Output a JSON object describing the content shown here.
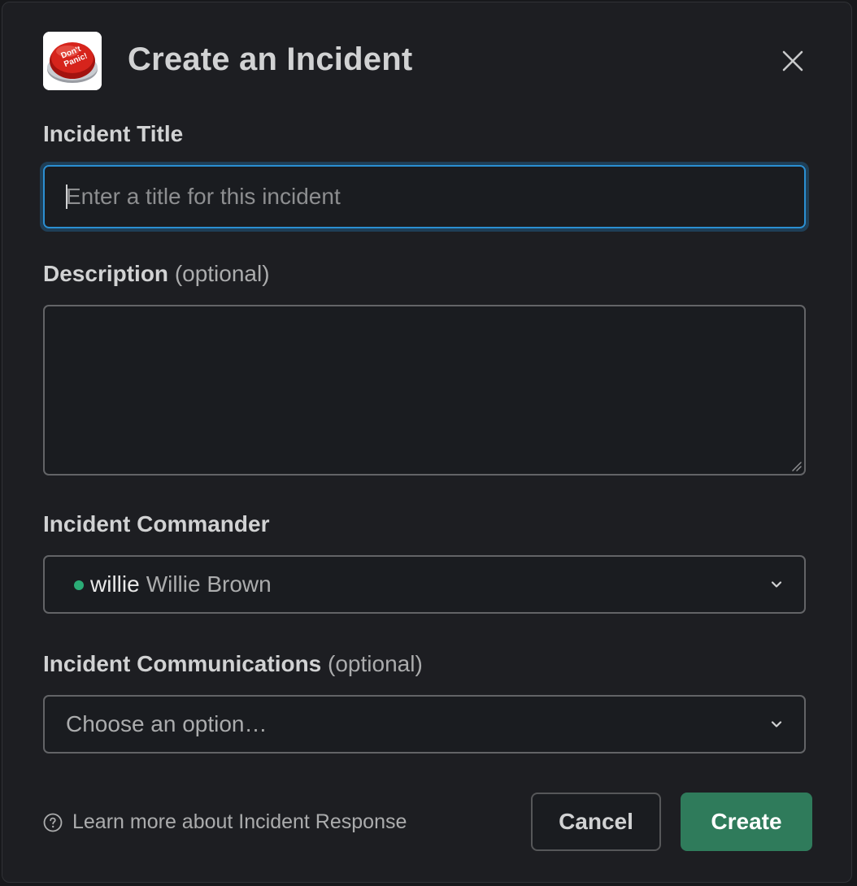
{
  "header": {
    "title": "Create an Incident",
    "app_icon": "dont-panic-button-icon",
    "app_icon_text": "Don't Panic!",
    "close_icon": "close-icon"
  },
  "form": {
    "title_field": {
      "label": "Incident Title",
      "placeholder": "Enter a title for this incident",
      "value": ""
    },
    "description_field": {
      "label": "Description",
      "optional_label": "(optional)",
      "value": ""
    },
    "commander_field": {
      "label": "Incident Commander",
      "selected_handle": "willie",
      "selected_name": "Willie Brown",
      "presence": "active"
    },
    "communications_field": {
      "label": "Incident Communications",
      "optional_label": "(optional)",
      "placeholder": "Choose an option…"
    }
  },
  "footer": {
    "help_icon": "question-circle-icon",
    "learn_more_link": "Learn more about Incident Response",
    "cancel_label": "Cancel",
    "create_label": "Create"
  },
  "colors": {
    "background": "#1d1e22",
    "focus_border": "#2b8fd2",
    "primary_button": "#2f7b5b",
    "presence_active": "#2bac76"
  }
}
